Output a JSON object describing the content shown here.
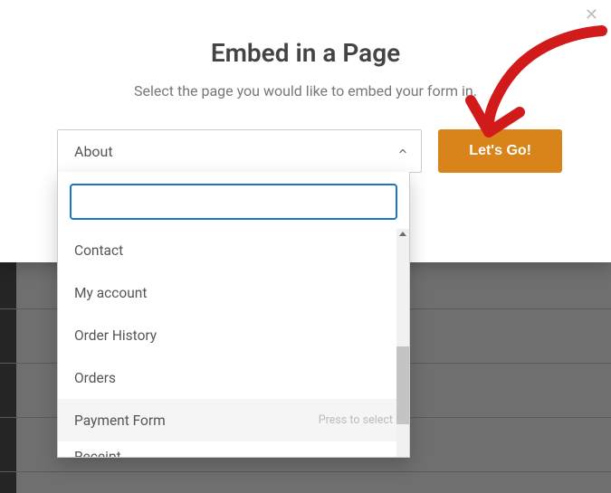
{
  "modal": {
    "title": "Embed in a Page",
    "subtitle": "Select the page you would like to embed your form in.",
    "close_label": "✕"
  },
  "select": {
    "selected_label": "About",
    "search_value": "",
    "press_hint": "Press to select",
    "options": [
      {
        "label": "Contact",
        "hovered": false
      },
      {
        "label": "My account",
        "hovered": false
      },
      {
        "label": "Order History",
        "hovered": false
      },
      {
        "label": "Orders",
        "hovered": false
      },
      {
        "label": "Payment Form",
        "hovered": true
      },
      {
        "label": "Receipt",
        "hovered": false
      }
    ]
  },
  "button": {
    "go_label": "Let's Go!"
  },
  "colors": {
    "accent": "#d8841a",
    "focus": "#1976c5",
    "annotation": "#d11b1b"
  }
}
